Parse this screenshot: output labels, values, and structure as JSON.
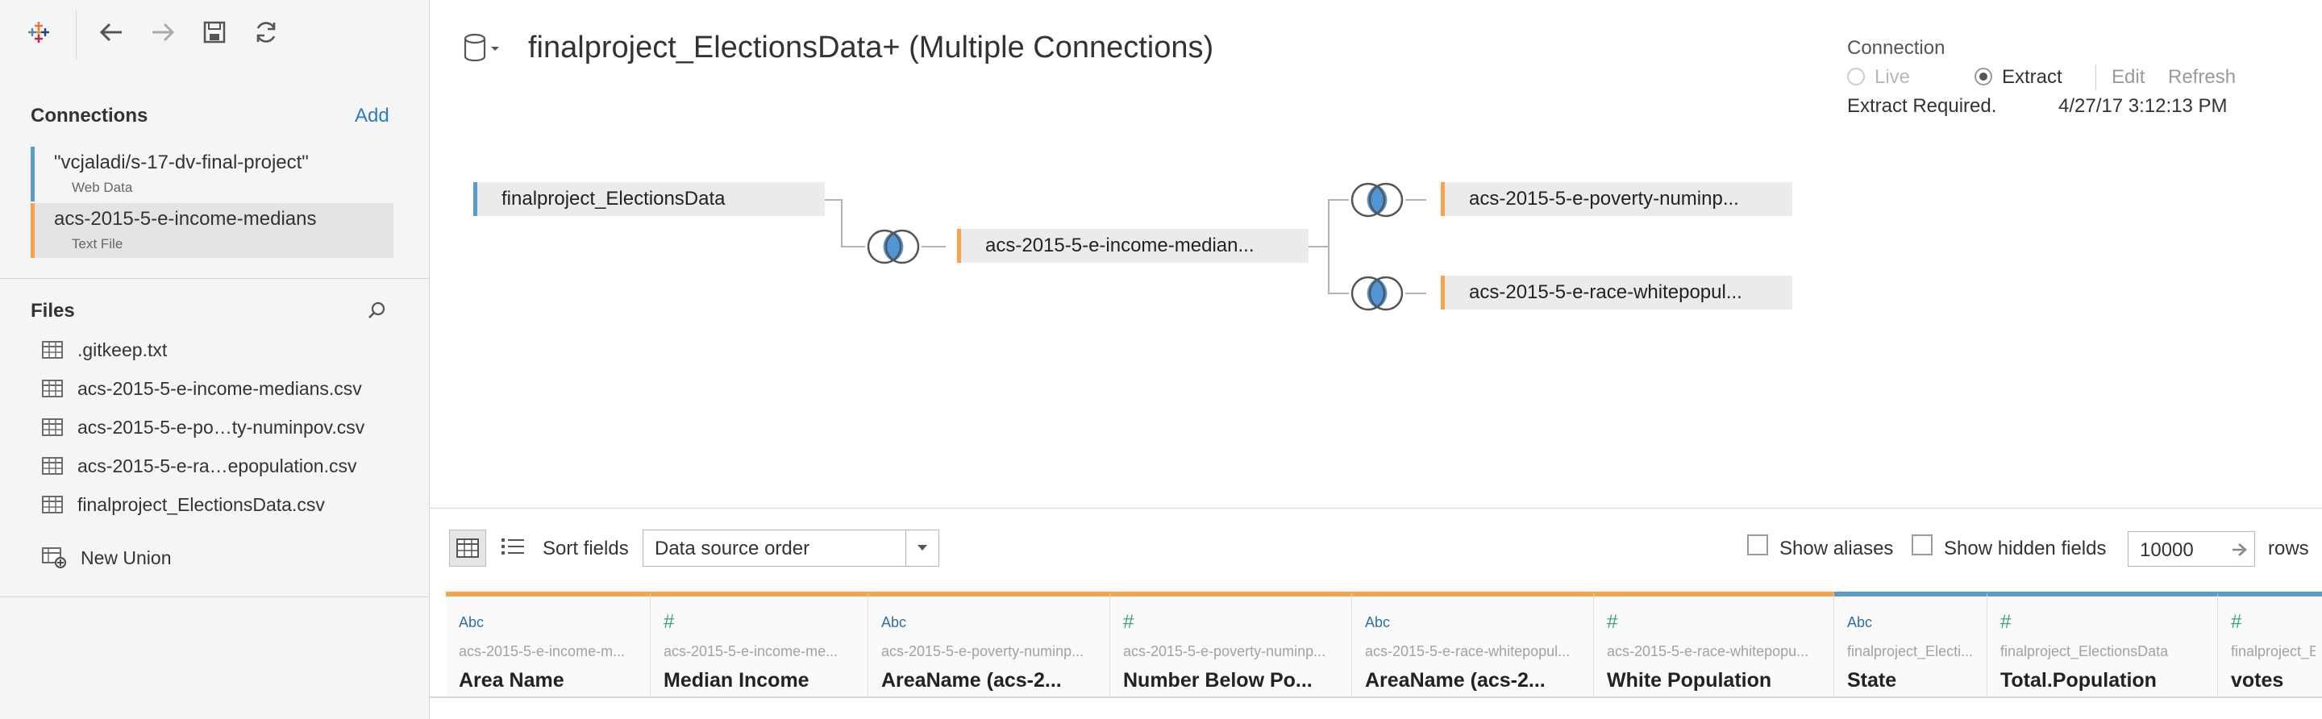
{
  "sidebar": {
    "connections_title": "Connections",
    "add_label": "Add",
    "connections": [
      {
        "name": "\"vcjaladi/s-17-dv-final-project\"",
        "type": "Web Data",
        "color": "#5b9bc8"
      },
      {
        "name": "acs-2015-5-e-income-medians",
        "type": "Text File",
        "color": "#f5a34c"
      }
    ],
    "files_title": "Files",
    "files": [
      ".gitkeep.txt",
      "acs-2015-5-e-income-medians.csv",
      "acs-2015-5-e-po…ty-numinpov.csv",
      "acs-2015-5-e-ra…epopulation.csv",
      "finalproject_ElectionsData.csv"
    ],
    "new_union": "New Union"
  },
  "header": {
    "title": "finalproject_ElectionsData+ (Multiple Connections)"
  },
  "connection_panel": {
    "title": "Connection",
    "live": "Live",
    "extract": "Extract",
    "edit": "Edit",
    "refresh": "Refresh",
    "status": "Extract Required.",
    "timestamp": "4/27/17 3:12:13 PM"
  },
  "canvas": {
    "tables": [
      "finalproject_ElectionsData",
      "acs-2015-5-e-income-median...",
      "acs-2015-5-e-poverty-numinp...",
      "acs-2015-5-e-race-whitepopul..."
    ]
  },
  "grid_toolbar": {
    "sort_label": "Sort fields",
    "sort_value": "Data source order",
    "show_aliases": "Show aliases",
    "show_hidden": "Show hidden fields",
    "rows_value": "10000",
    "rows_label": "rows"
  },
  "columns": [
    {
      "type": "Abc",
      "source": "acs-2015-5-e-income-m...",
      "name": "Area Name"
    },
    {
      "type": "#",
      "source": "acs-2015-5-e-income-me...",
      "name": "Median Income"
    },
    {
      "type": "Abc",
      "source": "acs-2015-5-e-poverty-numinp...",
      "name": "AreaName (acs-2..."
    },
    {
      "type": "#",
      "source": "acs-2015-5-e-poverty-numinp...",
      "name": "Number Below Po..."
    },
    {
      "type": "Abc",
      "source": "acs-2015-5-e-race-whitepopul...",
      "name": "AreaName (acs-2..."
    },
    {
      "type": "#",
      "source": "acs-2015-5-e-race-whitepopu...",
      "name": "White Population"
    },
    {
      "type": "Abc",
      "source": "finalproject_Electi...",
      "name": "State"
    },
    {
      "type": "#",
      "source": "finalproject_ElectionsData",
      "name": "Total.Population"
    },
    {
      "type": "#",
      "source": "finalproject_E",
      "name": "votes"
    }
  ]
}
